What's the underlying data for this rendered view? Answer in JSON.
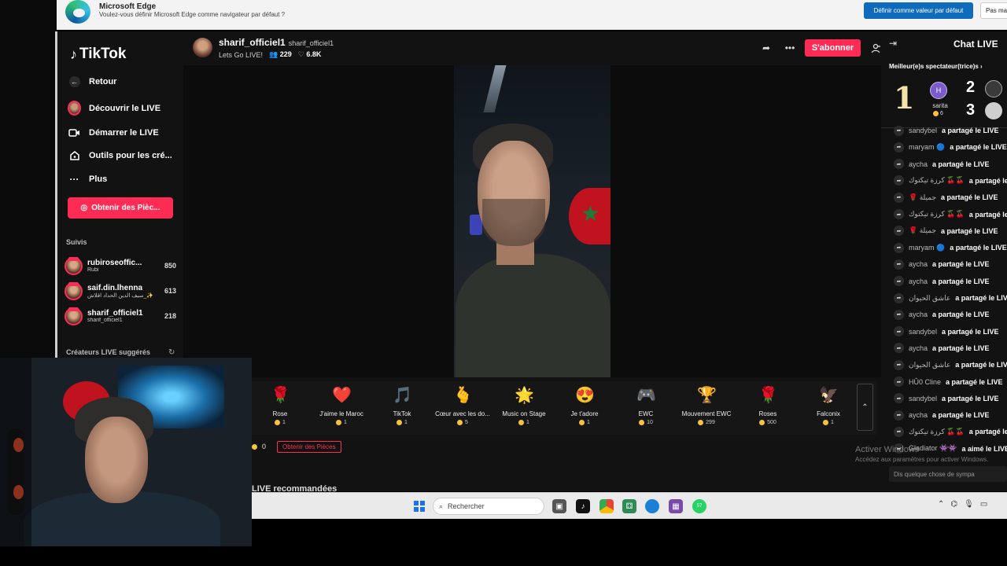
{
  "edge_banner": {
    "title": "Microsoft Edge",
    "subtitle": "Voulez-vous définir Microsoft Edge comme navigateur par défaut ?",
    "primary_button": "Définir comme valeur par défaut",
    "secondary_button": "Pas maintenant"
  },
  "sidebar": {
    "logo": "TikTok",
    "nav": [
      {
        "label": "Retour",
        "icon": "back-arrow-icon"
      },
      {
        "label": "Découvrir le LIVE",
        "icon": "avatar-icon"
      },
      {
        "label": "Démarrer le LIVE",
        "icon": "camera-icon"
      },
      {
        "label": "Outils pour les cré...",
        "icon": "house-icon"
      },
      {
        "label": "Plus",
        "icon": "more-dots-icon"
      }
    ],
    "coins_button": "Obtenir des Pièc...",
    "following_title": "Suivis",
    "following": [
      {
        "name": "rubiroseoffic...",
        "sub": "Rubi",
        "count": "850"
      },
      {
        "name": "saif.din.lhenna",
        "sub": "سيف الدين الحداد اقلاش_✨",
        "count": "613"
      },
      {
        "name": "sharif_officiel1",
        "sub": "sharif_officiel1",
        "count": "218"
      }
    ],
    "suggested_title": "Créateurs LIVE suggérés"
  },
  "stream": {
    "host_name": "sharif_officiel1",
    "host_handle": "sharif_officiel1",
    "status": "Lets Go LIVE!",
    "viewers": "229",
    "likes": "6.8K",
    "subscribe_label": "S'abonner"
  },
  "gifts": [
    {
      "name": "Rose",
      "price": "1",
      "icon": "🌹"
    },
    {
      "name": "J'aime le Maroc",
      "price": "1",
      "icon": "❤️"
    },
    {
      "name": "TikTok",
      "price": "1",
      "icon": "🎵"
    },
    {
      "name": "Cœur avec les do...",
      "price": "5",
      "icon": "🫰"
    },
    {
      "name": "Music on Stage",
      "price": "1",
      "icon": "🌟"
    },
    {
      "name": "Je t'adore",
      "price": "1",
      "icon": "😍"
    },
    {
      "name": "EWC",
      "price": "10",
      "icon": "🎮"
    },
    {
      "name": "Mouvement EWC",
      "price": "299",
      "icon": "🏆"
    },
    {
      "name": "Roses",
      "price": "500",
      "icon": "🌹"
    },
    {
      "name": "Falconix",
      "price": "1",
      "icon": "🦅"
    }
  ],
  "coins_bar": {
    "balance": "0",
    "get_coins": "Obtenir des Pièces"
  },
  "recommended_title": "LIVE recommandées",
  "chat": {
    "title": "Chat LIVE",
    "top_viewers_label": "Meilleur(e)s spectateur(trice)s",
    "viewer1": {
      "rank": "1",
      "initial": "H",
      "name": "sarita",
      "score": "6"
    },
    "rank2": "2",
    "rank3": "3",
    "messages": [
      {
        "user": "sandybel",
        "action": "a partagé le LIVE"
      },
      {
        "user": "maryam 🔵",
        "action": "a partagé le LIVE"
      },
      {
        "user": "aycha",
        "action": "a partagé le LIVE"
      },
      {
        "user": "كرزة تيكتوك 🍒🍒",
        "action": "a partagé le LIVE"
      },
      {
        "user": "🌹 جميلة",
        "action": "a partagé le LIVE"
      },
      {
        "user": "كرزة تيكتوك 🍒🍒",
        "action": "a partagé le LIVE"
      },
      {
        "user": "🌹 جميلة",
        "action": "a partagé le LIVE"
      },
      {
        "user": "maryam 🔵",
        "action": "a partagé le LIVE"
      },
      {
        "user": "aycha",
        "action": "a partagé le LIVE"
      },
      {
        "user": "aycha",
        "action": "a partagé le LIVE"
      },
      {
        "user": "عاشق الحيوان",
        "action": "a partagé le LIVE"
      },
      {
        "user": "aycha",
        "action": "a partagé le LIVE"
      },
      {
        "user": "sandybel",
        "action": "a partagé le LIVE"
      },
      {
        "user": "aycha",
        "action": "a partagé le LIVE"
      },
      {
        "user": "عاشق الحيوان",
        "action": "a partagé le LIVE"
      },
      {
        "user": "HÛ0 Cline",
        "action": "a partagé le LIVE"
      },
      {
        "user": "sandybel",
        "action": "a partagé le LIVE"
      },
      {
        "user": "aycha",
        "action": "a partagé le LIVE"
      },
      {
        "user": "كرزة تيكتوك 🍒🍒",
        "action": "a partagé le LIVE"
      },
      {
        "user": "Gladiator 👾👾",
        "action": "a aimé le LIVE"
      }
    ],
    "input_placeholder": "Dis quelque chose de sympa"
  },
  "watermark": {
    "title": "Activer Windows",
    "sub": "Accédez aux paramètres pour activer Windows."
  },
  "taskbar": {
    "search_placeholder": "Rechercher",
    "badge": "57"
  }
}
